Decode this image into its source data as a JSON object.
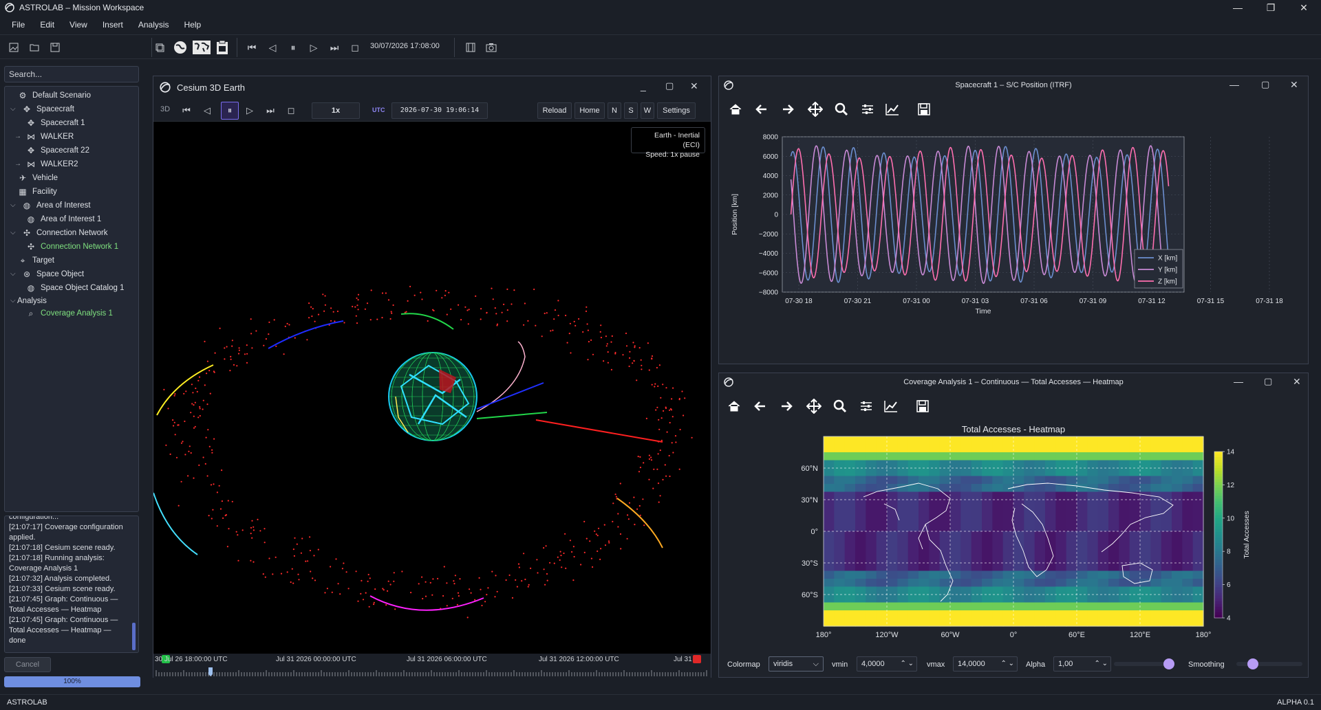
{
  "window": {
    "title": "ASTROLAB – Mission Workspace"
  },
  "menu": [
    "File",
    "Edit",
    "View",
    "Insert",
    "Analysis",
    "Help"
  ],
  "toolbar": {
    "time": "30/07/2026 17:08:00"
  },
  "search": {
    "placeholder": "Search..."
  },
  "tree": [
    {
      "label": "Default Scenario",
      "icon": "gear-icon"
    },
    {
      "label": "Spacecraft",
      "icon": "satellite-icon"
    },
    {
      "label": "Spacecraft 1",
      "icon": "satellite-icon"
    },
    {
      "label": "WALKER",
      "icon": "constellation-icon"
    },
    {
      "label": "Spacecraft 22",
      "icon": "satellite-icon"
    },
    {
      "label": "WALKER2",
      "icon": "constellation-icon"
    },
    {
      "label": "Vehicle",
      "icon": "plane-icon"
    },
    {
      "label": "Facility",
      "icon": "building-icon"
    },
    {
      "label": "Area of Interest",
      "icon": "globe-icon"
    },
    {
      "label": "Area of Interest 1",
      "icon": "globe-icon"
    },
    {
      "label": "Connection Network",
      "icon": "network-icon"
    },
    {
      "label": "Connection Network 1",
      "icon": "network-icon"
    },
    {
      "label": "Target",
      "icon": "pin-icon"
    },
    {
      "label": "Space Object",
      "icon": "orbit-icon"
    },
    {
      "label": "Space Object Catalog 1",
      "icon": "globe-icon"
    },
    {
      "label": "Analysis",
      "icon": ""
    },
    {
      "label": "Coverage Analysis 1",
      "icon": "magnifier-icon"
    }
  ],
  "log": [
    "configuration...",
    "[21:07:17] Coverage configuration",
    "applied.",
    "[21:07:18] Cesium scene ready.",
    "[21:07:18] Running analysis:",
    "Coverage Analysis 1",
    "[21:07:32] Analysis completed.",
    "[21:07:33] Cesium scene ready.",
    "[21:07:45] Graph: Continuous —",
    "Total Accesses — Heatmap",
    "[21:07:45] Graph: Continuous —",
    "Total Accesses — Heatmap —",
    "done"
  ],
  "cancel_label": "Cancel",
  "progress": {
    "value": 1.0,
    "label": "100%"
  },
  "viewer": {
    "title": "Cesium 3D Earth",
    "mode": "3D",
    "speed": "1x",
    "utc_label": "UTC",
    "datetime": "2026-07-30 19:06:14",
    "buttons": [
      "Reload",
      "Home",
      "N",
      "S",
      "W",
      "Settings"
    ],
    "info_line1": "Earth - Inertial (ECI)",
    "info_line2": "Speed: 1x pause",
    "timeline_labels": [
      "30 Jul 26 18:00:00 UTC",
      "Jul 31 2026 00:00:00 UTC",
      "Jul 31 2026 06:00:00 UTC",
      "Jul 31 2026 12:00:00 UTC",
      "Jul 31"
    ],
    "colors": {
      "accent": "#7a6cf0",
      "orbit_dots": "#ff2b2b"
    }
  },
  "pos_panel": {
    "title": "Spacecraft 1 – S/C Position (ITRF)",
    "chart_data": {
      "type": "line",
      "xlabel": "Time",
      "ylabel": "Position [km]",
      "ylim": [
        -8000,
        8000
      ],
      "yticks": [
        "8000",
        "6000",
        "4000",
        "2000",
        "0",
        "−2000",
        "−4000",
        "−6000",
        "−8000"
      ],
      "xticks": [
        "07-30 18",
        "07-30 21",
        "07-31 00",
        "07-31 03",
        "07-31 06",
        "07-31 09",
        "07-31 12",
        "07-31 15",
        "07-31 18"
      ],
      "grid": true,
      "legend": "bottom-right",
      "series": [
        {
          "name": "X [km]",
          "color": "#6c8fd0",
          "amplitude": 7000,
          "period_h": 1.55,
          "phase": 1.2
        },
        {
          "name": "Y [km]",
          "color": "#c98ad6",
          "amplitude": 7100,
          "period_h": 1.55,
          "phase": 2.6
        },
        {
          "name": "Z [km]",
          "color": "#ff6fb0",
          "amplitude": 6900,
          "period_h": 1.55,
          "phase": 0.0
        }
      ]
    }
  },
  "heat_panel": {
    "title": "Coverage Analysis 1 – Continuous — Total Accesses — Heatmap",
    "chart_data": {
      "type": "heatmap",
      "title": "Total Accesses - Heatmap",
      "colorbar_label": "Total Accesses",
      "colorbar_range": [
        4,
        14
      ],
      "colorbar_ticks": [
        "14",
        "12",
        "10",
        "8",
        "6",
        "4"
      ],
      "xticks": [
        "180°",
        "120°W",
        "60°W",
        "0°",
        "60°E",
        "120°E",
        "180°"
      ],
      "yticks": [
        "60°N",
        "30°N",
        "0°",
        "30°S",
        "60°S"
      ],
      "colormap": "viridis"
    },
    "controls": {
      "colormap_label": "Colormap",
      "colormap_value": "viridis",
      "vmin_label": "vmin",
      "vmin_value": "4,0000",
      "vmax_label": "vmax",
      "vmax_value": "14,0000",
      "alpha_label": "Alpha",
      "alpha_value": "1,00",
      "smoothing_label": "Smoothing"
    }
  },
  "status": {
    "left": "ASTROLAB",
    "right": "ALPHA 0.1"
  }
}
